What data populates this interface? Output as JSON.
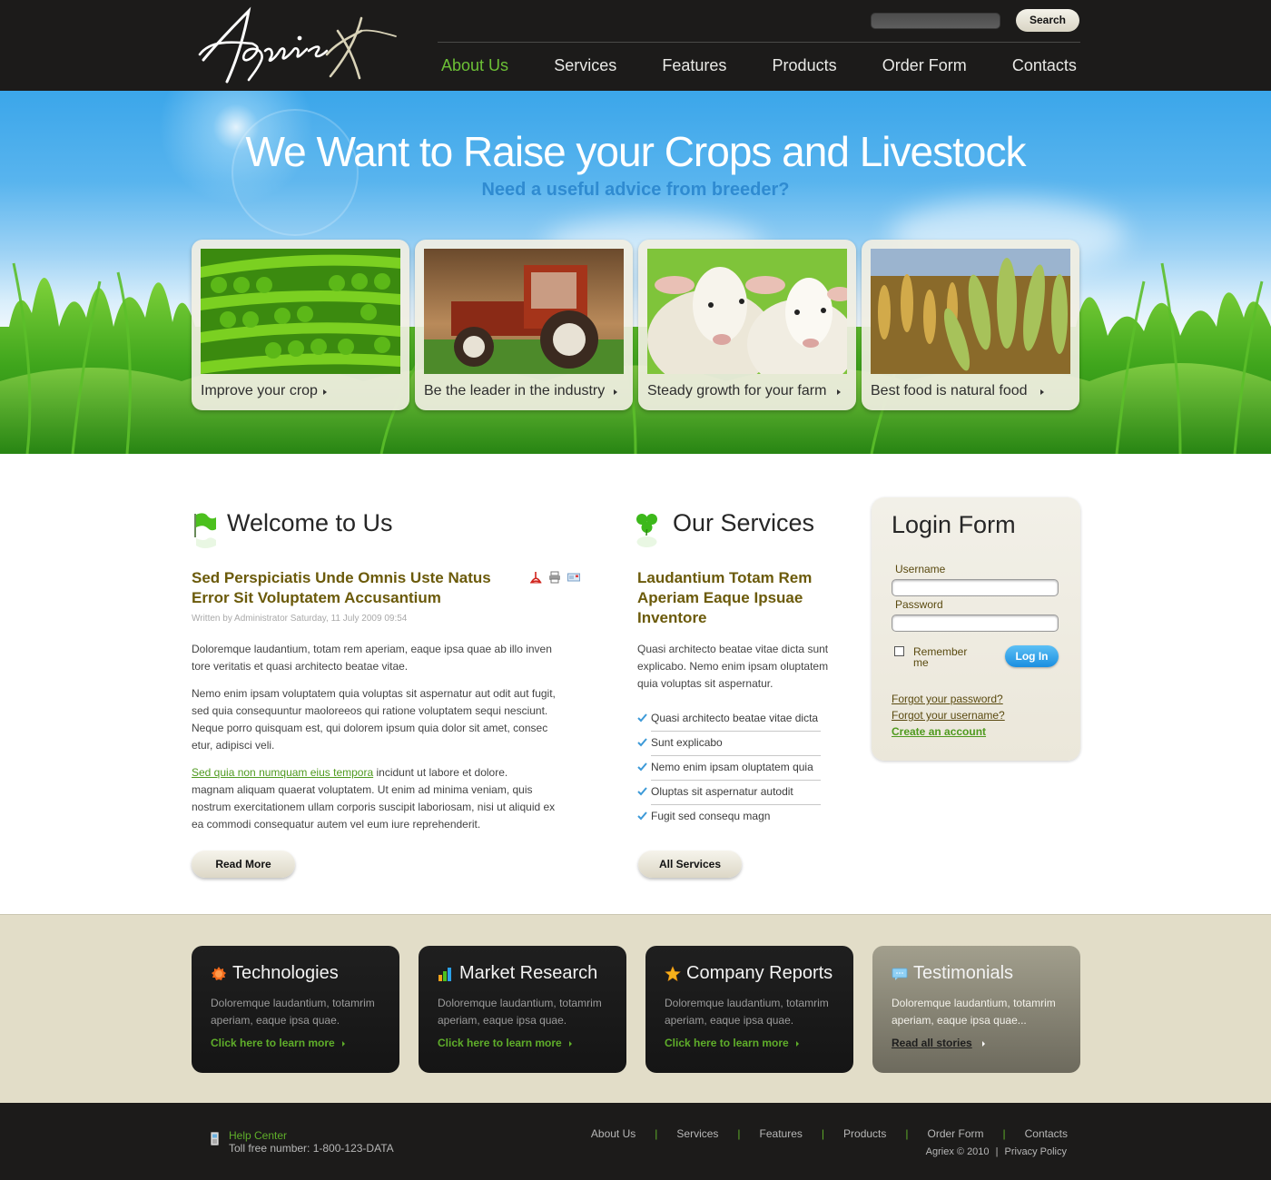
{
  "header": {
    "logo_text": "Agriex",
    "search": {
      "placeholder": "",
      "value": "",
      "button_label": "Search"
    },
    "nav": [
      {
        "label": "About Us",
        "active": true
      },
      {
        "label": "Services",
        "active": false
      },
      {
        "label": "Features",
        "active": false
      },
      {
        "label": "Products",
        "active": false
      },
      {
        "label": "Order Form",
        "active": false
      },
      {
        "label": "Contacts",
        "active": false
      }
    ]
  },
  "hero": {
    "title": "We Want to Raise your Crops and Livestock",
    "subtitle": "Need a useful advice from breeder?",
    "tiles": [
      {
        "caption": "Improve your crop",
        "image": "peas"
      },
      {
        "caption": "Be the leader in the industry",
        "image": "tractor"
      },
      {
        "caption": "Steady growth for your farm",
        "image": "sheep"
      },
      {
        "caption": "Best food is natural food",
        "image": "wheat"
      }
    ]
  },
  "welcome": {
    "title": "Welcome to Us",
    "icon": "green-flag-icon",
    "article_title_line1": "Sed Perspiciatis Unde Omnis Uste Natus",
    "article_title_line2": "Error Sit Voluptatem Accusantium",
    "meta": "Written by Administrator Saturday, 11 July 2009 09:54",
    "tools": [
      "pdf-icon",
      "print-icon",
      "email-icon"
    ],
    "para1_line1": "Doloremque laudantium, totam rem aperiam, eaque ipsa quae ab illo inven",
    "para1_line2": "tore veritatis et quasi architecto beatae vitae.",
    "para2_line1": "Nemo enim ipsam voluptatem quia voluptas sit aspernatur aut odit aut fugit,",
    "para2_line2": "sed quia consequuntur maoloreeos qui ratione voluptatem sequi nesciunt.",
    "para2_line3": "Neque porro quisquam est, qui dolorem ipsum quia dolor sit amet, consec",
    "para2_line4": "etur, adipisci veli.",
    "para3_link": "Sed quia non numquam eius tempora",
    "para3_line1_rest": " incidunt ut labore et dolore.",
    "para3_line2": " magnam aliquam quaerat voluptatem. Ut enim ad minima veniam, quis",
    "para3_line3": "nostrum exercitationem ullam corporis suscipit laboriosam, nisi ut aliquid ex",
    "para3_line4": "ea commodi consequatur autem vel eum iure reprehenderit.",
    "button_label": "Read More"
  },
  "services": {
    "title": "Our Services",
    "icon": "clover-icon",
    "article_title_line1": "Laudantium Totam Rem",
    "article_title_line2": "Aperiam Eaque Ipsuae",
    "article_title_line3": "Inventore",
    "intro_line1": "Quasi architecto beatae vitae dicta sunt",
    "intro_line2": "explicabo. Nemo enim ipsam oluptatem",
    "intro_line3": "quia voluptas sit aspernatur.",
    "items": [
      "Quasi architecto beatae vitae dicta",
      "Sunt explicabo",
      "Nemo enim ipsam oluptatem quia",
      "Oluptas sit aspernatur autodit",
      "Fugit sed consequ magn"
    ],
    "button_label": "All Services"
  },
  "login": {
    "title": "Login Form",
    "username_label": "Username",
    "username_value": "",
    "password_label": "Password",
    "password_value": "",
    "remember_label_1": "Remember",
    "remember_label_2": "me",
    "remember_checked": false,
    "button_label": "Log In",
    "forgot_password": "Forgot your password?",
    "forgot_username": "Forgot your username?",
    "create_account": "Create an account"
  },
  "features": [
    {
      "title": "Technologies",
      "icon": "orange-gear-icon",
      "text_line1": "Doloremque laudantium, totamrim",
      "text_line2": "aperiam, eaque ipsa quae.",
      "link": "Click here to learn more"
    },
    {
      "title": "Market Research",
      "icon": "bar-chart-icon",
      "text_line1": "Doloremque laudantium, totamrim",
      "text_line2": "aperiam, eaque ipsa quae.",
      "link": "Click here to learn more"
    },
    {
      "title": "Company Reports",
      "icon": "star-icon",
      "text_line1": "Doloremque laudantium, totamrim",
      "text_line2": "aperiam, eaque ipsa quae.",
      "link": "Click here to learn more"
    },
    {
      "title": "Testimonials",
      "icon": "speech-bubble-icon",
      "text_line1": "Doloremque laudantium, totamrim",
      "text_line2": "aperiam, eaque ipsa quae...",
      "link": "Read all stories"
    }
  ],
  "footer": {
    "help_title": "Help Center",
    "toll_free": "Toll free number: 1-800-123-DATA",
    "nav": [
      "About Us",
      "Services",
      "Features",
      "Products",
      "Order Form",
      "Contacts"
    ],
    "separator": "|",
    "copyright": "Agriex © 2010",
    "copy_sep": "|",
    "privacy": "Privacy Policy"
  },
  "colors": {
    "accent_green": "#6cc036",
    "header_bg": "#1c1b1a",
    "article_title": "#6b5a0a",
    "login_button": "#1a8ee0",
    "band_bg": "#e2ddc8"
  }
}
